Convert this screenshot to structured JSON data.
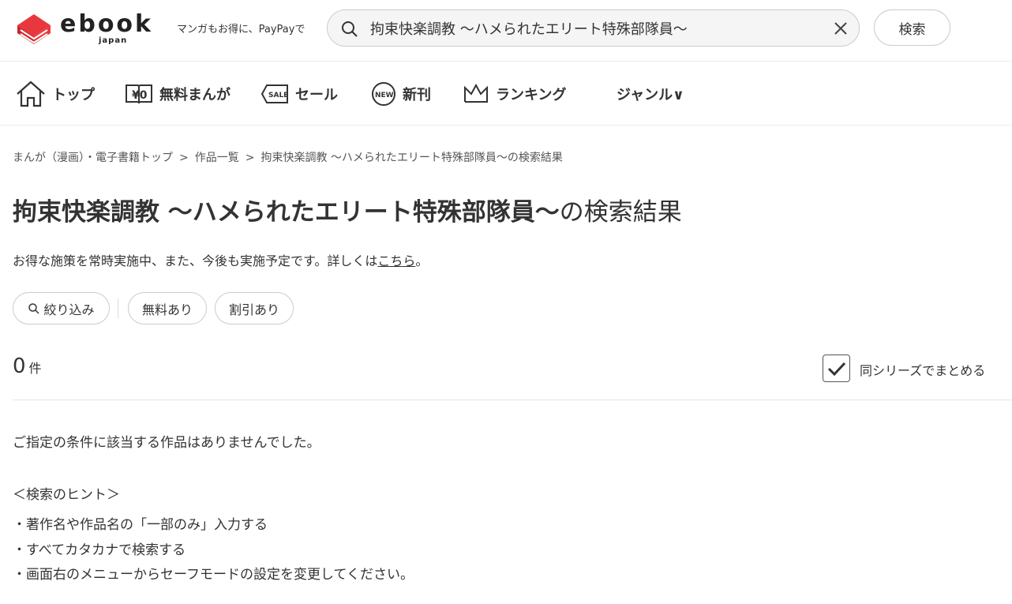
{
  "header": {
    "logo_text": "ebook",
    "logo_sub": "japan",
    "tagline": "マンガもお得に、PayPayで",
    "search_value": "拘束快楽調教 ～ハメられたエリート特殊部隊員～",
    "search_button": "検索",
    "brand_color": "#e8383d"
  },
  "nav": {
    "items": [
      {
        "label": "トップ",
        "icon": "home-icon"
      },
      {
        "label": "無料まんが",
        "icon": "yen-book-icon"
      },
      {
        "label": "セール",
        "icon": "sale-tag-icon"
      },
      {
        "label": "新刊",
        "icon": "new-badge-icon"
      },
      {
        "label": "ランキング",
        "icon": "crown-icon"
      },
      {
        "label": "ジャンル∨",
        "icon": ""
      }
    ]
  },
  "breadcrumb": {
    "items": [
      "まんが（漫画）・電子書籍トップ",
      "作品一覧",
      "拘束快楽調教 ～ハメられたエリート特殊部隊員～の検索結果"
    ],
    "separator": ">"
  },
  "title": {
    "keyword": "拘束快楽調教 ～ハメられたエリート特殊部隊員～",
    "suffix": "の検索結果"
  },
  "notice": {
    "text": "お得な施策を常時実施中、また、今後も実施予定です。詳しくは",
    "link": "こちら",
    "end": "。"
  },
  "filters": {
    "refine": "絞り込み",
    "free": "無料あり",
    "discount": "割引あり"
  },
  "results": {
    "count": "0",
    "unit": "件",
    "series_label": "同シリーズでまとめる",
    "series_checked": true
  },
  "empty": {
    "message": "ご指定の条件に該当する作品はありませんでした。",
    "hint_title": "＜検索のヒント＞",
    "hints": [
      "・著作名や作品名の「一部のみ」入力する",
      "・すべてカタカナで検索する",
      "・画面右のメニューからセーフモードの設定を変更してください。"
    ]
  }
}
